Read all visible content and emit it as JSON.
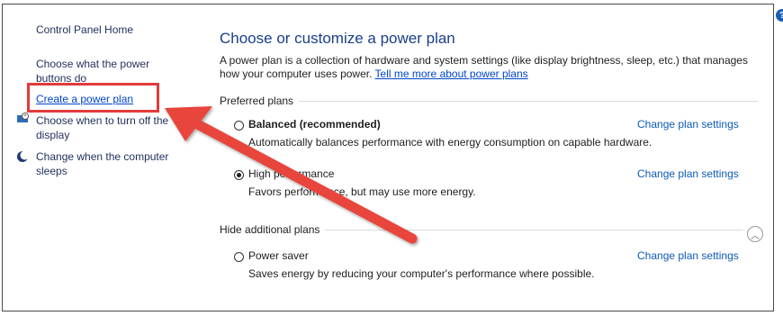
{
  "sidebar": {
    "home": "Control Panel Home",
    "items": [
      {
        "label": "Choose what the power buttons do",
        "line1": "Choose what the power",
        "line2": "buttons do"
      },
      {
        "label": "Create a power plan"
      },
      {
        "label": "Choose when to turn off the display",
        "line1": "Choose when to turn off the",
        "line2": "display",
        "icon": "monitor-clock-icon"
      },
      {
        "label": "Change when the computer sleeps",
        "line1": "Change when the computer",
        "line2": "sleeps",
        "icon": "moon-icon"
      }
    ]
  },
  "main": {
    "title": "Choose or customize a power plan",
    "description": "A power plan is a collection of hardware and system settings (like display brightness, sleep, etc.) that manages how your computer uses power.",
    "help_link": "Tell me more about power plans",
    "preferred_label": "Preferred plans",
    "hide_label": "Hide additional plans",
    "plans": [
      {
        "name": "Balanced (recommended)",
        "desc": "Automatically balances performance with energy consumption on capable hardware.",
        "selected": false,
        "link": "Change plan settings"
      },
      {
        "name": "High performance",
        "desc": "Favors performance, but may use more energy.",
        "selected": true,
        "link": "Change plan settings"
      },
      {
        "name": "Power saver",
        "desc": "Saves energy by reducing your computer's performance where possible.",
        "selected": false,
        "link": "Change plan settings"
      }
    ]
  },
  "colors": {
    "highlight": "#e23b3b",
    "link": "#0046c8",
    "title": "#1a3f8a"
  }
}
